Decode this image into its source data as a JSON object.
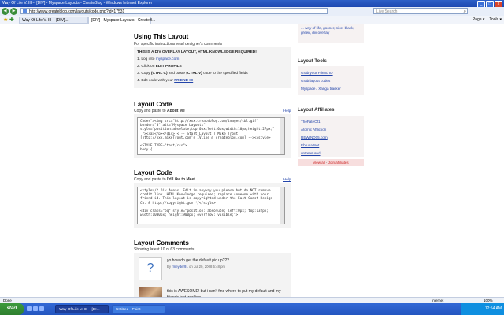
{
  "window": {
    "title": "Way Of Life V. III -- [DIV] - Myspace Layouts - CreateBlog - Windows Internet Explorer",
    "min": "_",
    "max": "□",
    "close": "x"
  },
  "address": {
    "url": "http://www.createblog.com/layouts/code.php?id=17531",
    "search_placeholder": "Live Search"
  },
  "tabs": [
    {
      "label": "Way Of Life V. III -- [DIV]..."
    },
    {
      "label": "[DIV] - Myspace Layouts - CreateB..."
    }
  ],
  "toolbar": {
    "page": "Page ▾",
    "tools": "Tools ▾"
  },
  "using": {
    "title": "Using This Layout",
    "subtitle": "For specific instructions read designer's comments",
    "notice": "THIS IS A DIV OVERLAY LAYOUT, HTML KNOWLEDGE REQUIRED!",
    "steps": [
      {
        "pre": "1. Log into ",
        "link": "myspace.com",
        "post": ""
      },
      {
        "pre": "2. Click on ",
        "bold": "EDIT PROFILE"
      },
      {
        "pre": "3. Copy ",
        "b1": "(CTRL C)",
        "mid": " and paste ",
        "b2": "(CTRL V)",
        "post": " code to the specified fields"
      },
      {
        "pre": "4. Edit code with your ",
        "link": "FRIEND ID"
      }
    ]
  },
  "code1": {
    "title": "Layout Code",
    "sub_pre": "Copy and paste to ",
    "sub_bold": "About Me",
    "help": "Help",
    "text": "Codes\"><img src=\"http://xxx.createblog.com/images/cbl.gif\"\nborder=\"0\" alt=\"Myspace Layouts\"\nstyle=\"position:absolute;top:0px;left:0px;width:10px;height:27px;\"\n /></a></p></div> <!-- Start Layout | Mike Trout\n[http://xxx.mikeTrout.com's IVlike @ createblog.com] --></style>\n\n<STYLE TYPE=\"text/css\">\nbody {"
  },
  "code2": {
    "title": "Layout Code",
    "sub_pre": "Copy and paste to ",
    "sub_bold": "I'd Like to Meet",
    "help": "Help",
    "text": "<style>/* Div Areas: Edit in anyway you please but do NOT remove\ncredit link. HTML Knowledge required; replace someone with your\nfriend id. This layout is copyrighted under the East Coast Design\nCo. & http://copyright.gov */</style>\n\n<div class=\"bq\" style=\"position: absolute; left:0px; top:132px;\nwidth:1000px; height:900px; overflow: visible;\">"
  },
  "comments": {
    "title": "Layout Comments",
    "subtitle": "Showing latest 10 of 63 comments",
    "items": [
      {
        "text": "yo how do get the default pic up???",
        "by": "By ",
        "user": "rmeyder91",
        "date": " on Jul 20, 2008 5:48 pm"
      },
      {
        "text1": "this is AWESOME! but i can't find where to put my default and my",
        "text2": "friends isnt working"
      }
    ]
  },
  "sidebar": {
    "tags": "... way of life, gooner, nike, black, green, div overlay",
    "tools_title": "Layout Tools",
    "tools": [
      "Grab your Friend ID",
      "Grab layout codes",
      "Myspace / Xanga tracker"
    ],
    "aff_title": "Layout Affiliates",
    "affiliates": [
      "TheFateOf1",
      "Atomic Affliction",
      "REWIND05.com",
      "Ebruna.Net",
      "untreasured"
    ],
    "view_all": "View all",
    "join": "Join affiliates"
  },
  "status": {
    "left": "Done",
    "zone": "Internet",
    "zoom": "100%"
  },
  "taskbar": {
    "start": "start",
    "tasks": [
      "Way Of Life V. III -- [DI...",
      "Untitled - Paint"
    ],
    "clock": "12:54 AM"
  }
}
